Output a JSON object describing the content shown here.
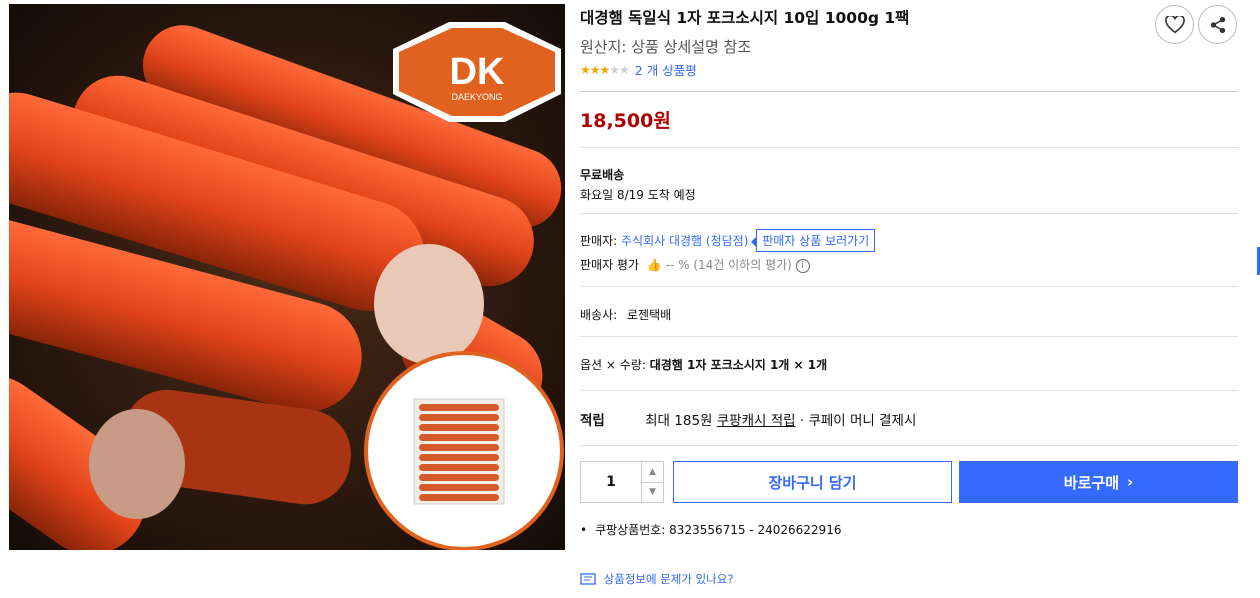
{
  "product": {
    "title": "대경햄 독일식 1자 포크소시지 10입 1000g 1팩",
    "origin": "원산지: 상품 상세설명 참조",
    "rating_value": 3,
    "rating_max": 5,
    "review_count": "2 개 상품평",
    "price": "18,500원",
    "brand_logo": {
      "text": "DK",
      "subtext": "DAEKYONG"
    }
  },
  "shipping": {
    "label": "무료배송",
    "arrival": "화요일 8/19 도착 예정"
  },
  "seller": {
    "label": "판매자:",
    "name": "주식회사 대경햄 (청담점)",
    "store_button": "판매자 상품 보러가기",
    "rating_label": "판매자 평가",
    "rating_text": "-- % (14건 이하의 평가)"
  },
  "delivery": {
    "label": "배송사:",
    "company": "로젠택배"
  },
  "option": {
    "label": "옵션 × 수량:",
    "value": "대경햄 1자 포크소시지 1개 × 1개"
  },
  "points": {
    "label": "적립",
    "max": "최대 185원",
    "cash_link": "쿠팡캐시 적립",
    "pay": "· 쿠페이 머니 결제시"
  },
  "purchase": {
    "quantity": "1",
    "cart_button": "장바구니 담기",
    "buy_button": "바로구매"
  },
  "product_number": "쿠팡상품번호: 8323556715 - 24026622916",
  "report_link": "상품정보에 문제가 있나요?",
  "icons": [
    "heart-icon",
    "share-icon",
    "chevron-up-icon",
    "chevron-down-icon",
    "chevron-right-icon",
    "thumbs-up-icon",
    "info-icon",
    "report-icon"
  ],
  "colors": {
    "accent": "#346aff",
    "price": "#ae0000",
    "star": "#f5a500",
    "logo": "#e0621e"
  }
}
